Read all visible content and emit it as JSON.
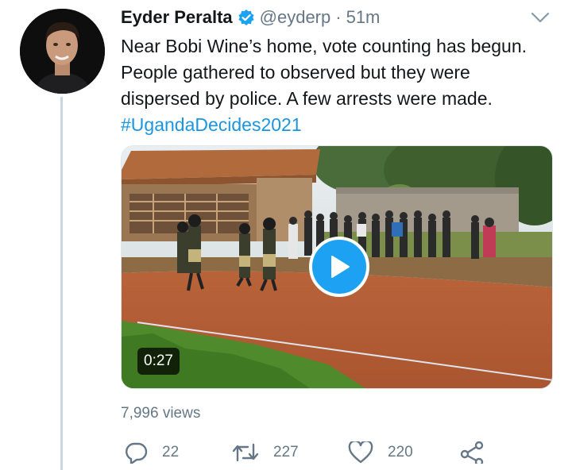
{
  "tweet": {
    "author_name": "Eyder Peralta",
    "handle": "@eyderp",
    "separator": "·",
    "time": "51m",
    "text": "Near Bobi Wine’s home, vote counting has begun. People gathered to observed but they were dispersed by police. A few arrests were made. ",
    "hashtag": "#UgandaDecides2021",
    "video_duration": "0:27",
    "views": "7,996 views",
    "reply_count": "22",
    "retweet_count": "227",
    "like_count": "220"
  },
  "colors": {
    "link": "#1b95e0",
    "secondary": "#657786",
    "play_button": "#1da1f2"
  },
  "icons": [
    "verified-badge-icon",
    "chevron-down-icon",
    "play-icon",
    "reply-icon",
    "retweet-icon",
    "like-icon",
    "share-icon"
  ]
}
